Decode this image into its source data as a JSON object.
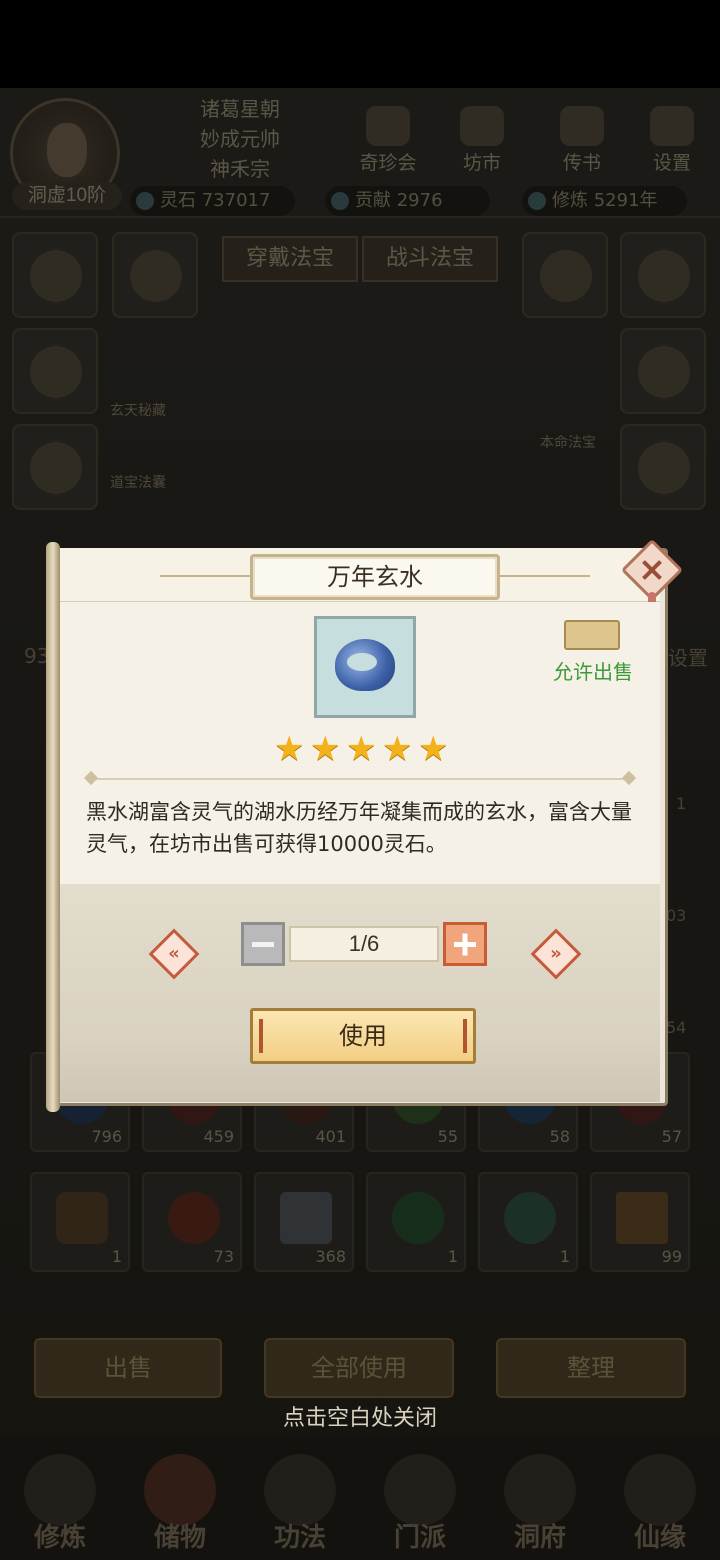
{
  "player": {
    "rank": "洞虚10阶",
    "titles": [
      "诸葛星朝",
      "妙成元帅",
      "神禾宗"
    ]
  },
  "header_nav": [
    "奇珍会",
    "坊市",
    "传书",
    "设置"
  ],
  "resources": {
    "spirit_stone": "灵石 737017",
    "contribution": "贡献 2976",
    "cultivation": "修炼 5291年"
  },
  "treasure_tabs": [
    "穿戴法宝",
    "战斗法宝"
  ],
  "side_labels": [
    "玄天秘藏",
    "道宝法囊",
    "本命法宝"
  ],
  "bg_partial": {
    "left_number": "93",
    "right_text": "设置"
  },
  "bag_counts": [
    "796",
    "459",
    "401",
    "55",
    "58",
    "57",
    "1",
    "73",
    "368",
    "1",
    "1",
    "99"
  ],
  "side_partial_counts": [
    "1",
    "03",
    "54"
  ],
  "bottom_buttons": {
    "sell": "出售",
    "use_all": "全部使用",
    "sort": "整理"
  },
  "bottom_nav": [
    "修炼",
    "储物",
    "功法",
    "门派",
    "洞府",
    "仙缘"
  ],
  "close_hint": "点击空白处关闭",
  "dialog": {
    "title": "万年玄水",
    "sell_label": "允许出售",
    "stars": 5,
    "description": "黑水湖富含灵气的湖水历经万年凝集而成的玄水，富含大量灵气，在坊市出售可获得10000灵石。",
    "quantity": "1/6",
    "use_label": "使用"
  },
  "icons": {
    "close": "close-icon",
    "prev": "double-chevron-left-icon",
    "next": "double-chevron-right-icon",
    "item": "dark-water-icon",
    "sell": "chest-icon",
    "star": "star-icon"
  }
}
